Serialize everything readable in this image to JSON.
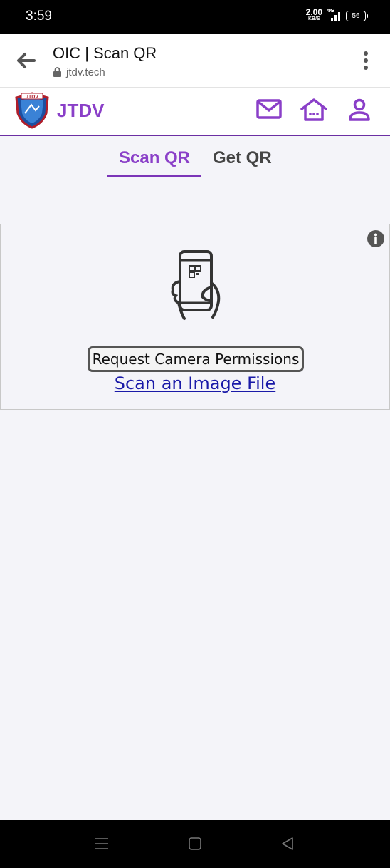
{
  "status_bar": {
    "time": "3:59",
    "net_speed": "2.00",
    "net_speed_unit": "KB/S",
    "network_type": "4G",
    "battery_level": "56"
  },
  "browser": {
    "page_title": "OIC | Scan QR",
    "url": "jtdv.tech"
  },
  "site_header": {
    "brand_name": "JTDV",
    "logo_text": "JTDV",
    "accent_color": "#8a3fc8"
  },
  "tabs": [
    {
      "label": "Scan QR",
      "active": true
    },
    {
      "label": "Get QR",
      "active": false
    }
  ],
  "scanner": {
    "request_permission_label": "Request Camera Permissions",
    "scan_file_link": "Scan an Image File"
  },
  "icons": [
    "back-arrow-icon",
    "lock-icon",
    "more-vert-icon",
    "mail-icon",
    "home-icon",
    "user-icon",
    "info-icon",
    "phone-qr-icon",
    "menu-icon",
    "home-square-icon",
    "back-triangle-icon"
  ]
}
